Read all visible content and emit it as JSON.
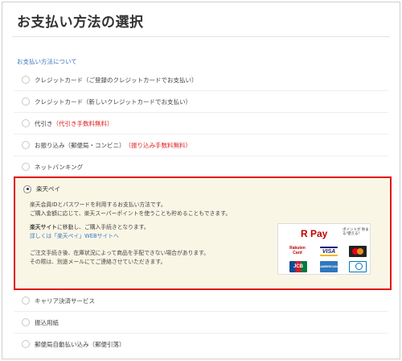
{
  "page": {
    "title": "お支払い方法の選択",
    "about_link": "お支払い方法について"
  },
  "options_top": [
    {
      "label": "クレジットカード（ご登録のクレジットカードでお支払い）",
      "note": ""
    },
    {
      "label": "クレジットカード（新しいクレジットカードでお支払い）",
      "note": ""
    },
    {
      "label": "代引き",
      "note": "（代引き手数料無料）"
    },
    {
      "label": "お振り込み（郵便局・コンビニ）",
      "note": "（振り込み手数料無料）"
    },
    {
      "label": "ネットバンキング",
      "note": ""
    }
  ],
  "rakuten_pay": {
    "label": "楽天ペイ",
    "desc1": "楽天会員IDとパスワードを利用するお支払い方法です。",
    "desc2": "ご購入金額に応じて、楽天スーパーポイントを使うことも貯めることもできます。",
    "move_bold": "楽天サイト",
    "move_rest": "に移動し、ご購入手続きとなります。",
    "details_link": "詳しくは「楽天ペイ」WEBサイトへ",
    "note1": "ご注文手続き後、在庫状況によって商品を手配できない場合があります。",
    "note2": "その際は、別途メールにてご連絡させていただきます。",
    "logo_text": "R Pay",
    "logo_sub": "ポイントが 貯まる!使える!",
    "card_rakuten": "Rakuten Card",
    "card_visa": "VISA",
    "card_jcb": "JCB",
    "card_amex": "AMERICAN EXPRESS"
  },
  "options_bottom": [
    {
      "label": "キャリア決済サービス"
    },
    {
      "label": "振込用紙"
    },
    {
      "label": "郵便局自動払い込み（郵便引落）"
    }
  ],
  "colors": {
    "accent_red": "#e21313",
    "link_blue": "#3a78c3",
    "highlight_bg": "#faf6e6"
  }
}
